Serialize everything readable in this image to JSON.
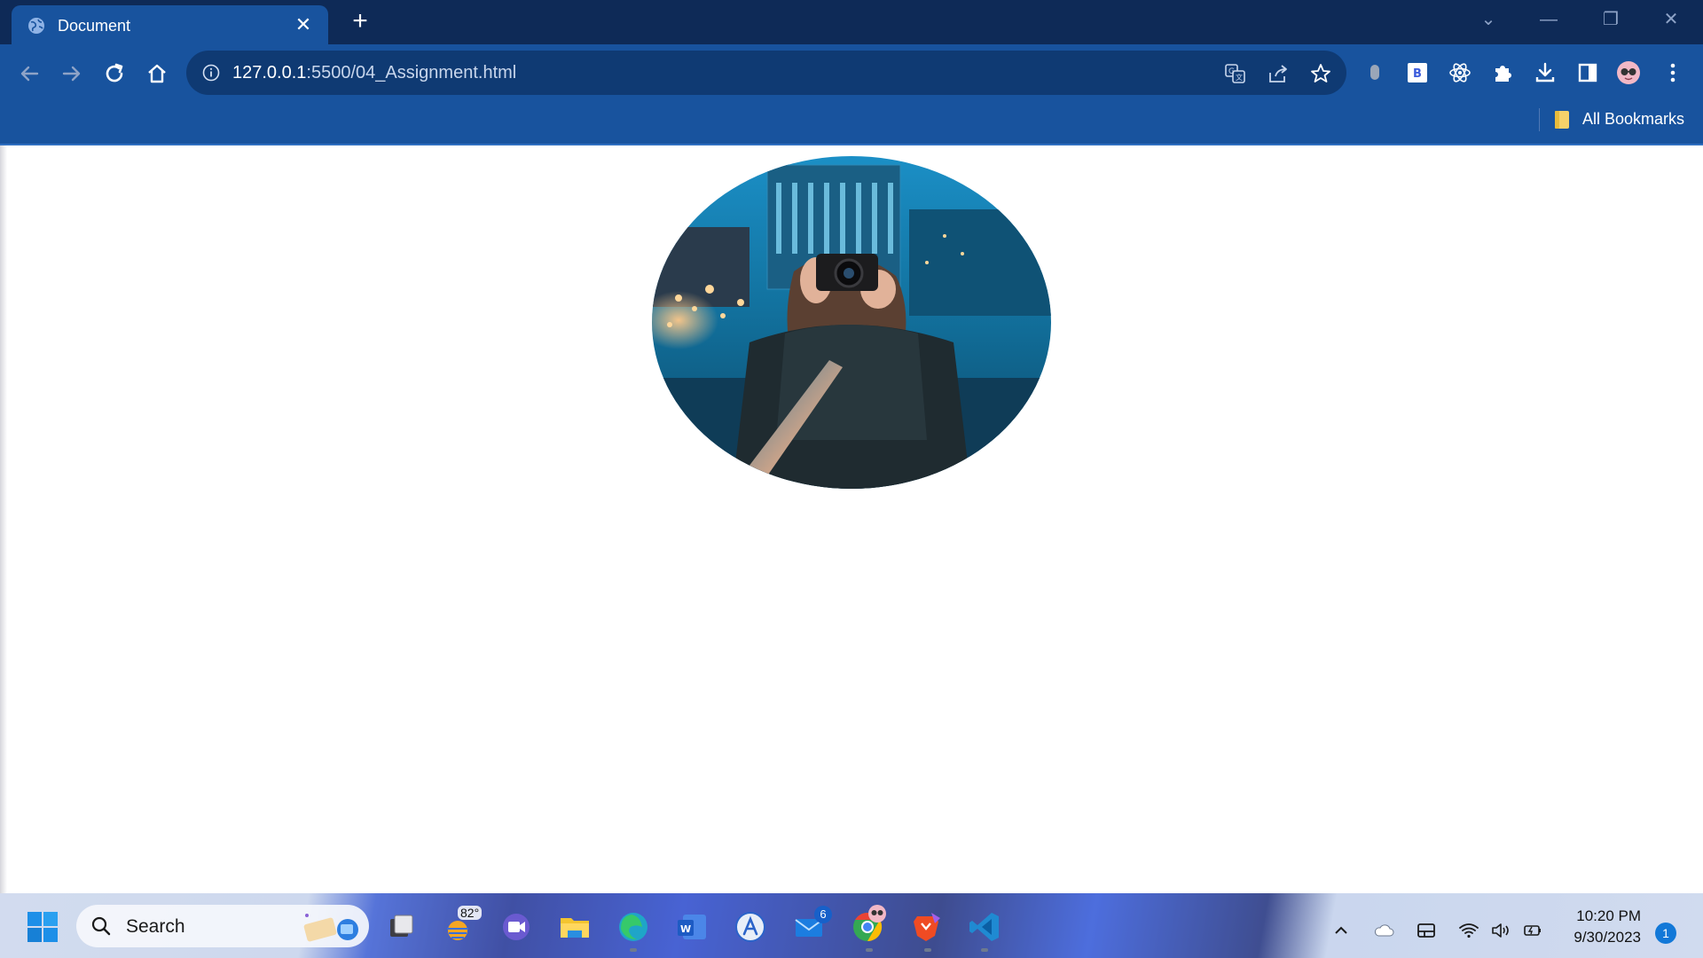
{
  "browser": {
    "tab": {
      "title": "Document",
      "close_glyph": "✕",
      "favicon": "globe-icon"
    },
    "new_tab_glyph": "+",
    "window_controls": {
      "collapse_tabs": "⌄",
      "minimize": "—",
      "restore": "❐",
      "close": "✕"
    },
    "address_bar": {
      "host": "127.0.0.1",
      "rest": ":5500/04_Assignment.html"
    },
    "bookmarks_bar": {
      "label": "All Bookmarks"
    },
    "colors": {
      "frame": "#0e2a57",
      "toolbar": "#18539e",
      "omnibox": "#0f3a73"
    }
  },
  "page": {
    "image": {
      "description_alt": "",
      "shape": "ellipse"
    }
  },
  "taskbar": {
    "search_label": "Search",
    "weather_temp": "82°",
    "mail_badge": "6",
    "clock": {
      "time": "10:20 PM",
      "date": "9/30/2023"
    },
    "notification_count": "1"
  }
}
